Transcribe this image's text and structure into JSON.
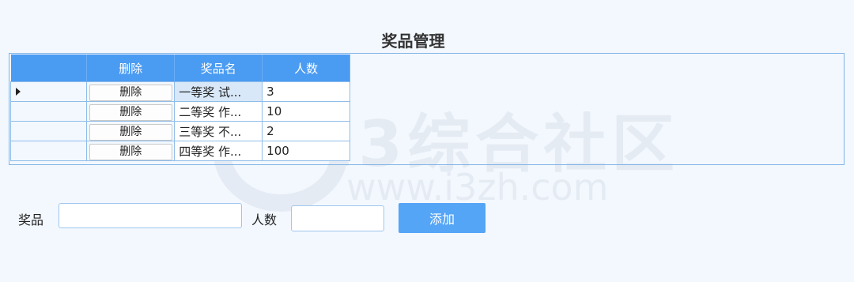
{
  "page": {
    "title": "奖品管理"
  },
  "grid": {
    "headers": [
      "删除",
      "奖品名",
      "人数"
    ],
    "rows": [
      {
        "delete_label": "删除",
        "name": "一等奖 试...",
        "count": "3"
      },
      {
        "delete_label": "删除",
        "name": "二等奖 作...",
        "count": "10"
      },
      {
        "delete_label": "删除",
        "name": "三等奖 不...",
        "count": "2"
      },
      {
        "delete_label": "删除",
        "name": "四等奖 作...",
        "count": "100"
      }
    ]
  },
  "form": {
    "prize_label": "奖品",
    "prize_value": "",
    "count_label": "人数",
    "count_value": "",
    "add_label": "添加"
  },
  "watermark": {
    "text": "i3综合社区",
    "url": "www.i3zh.com"
  },
  "colors": {
    "header": "#4a9bf2",
    "accent": "#55a5f7",
    "background": "#f3f8fe"
  }
}
